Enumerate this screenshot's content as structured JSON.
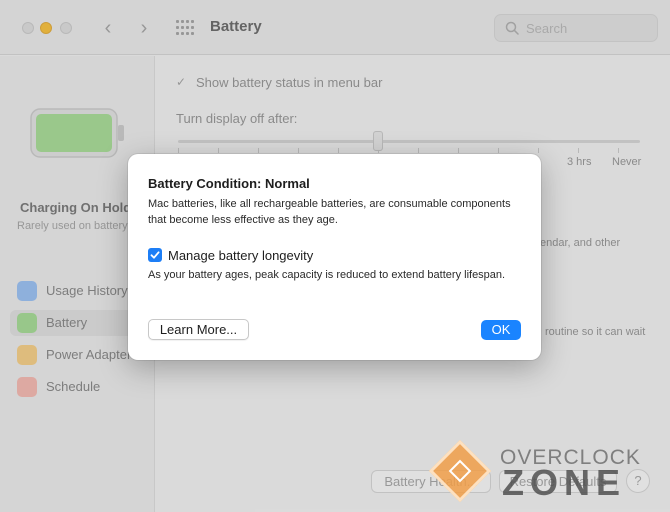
{
  "window": {
    "title": "Battery",
    "search_placeholder": "Search"
  },
  "sidebar": {
    "charging_title": "Charging On Hold",
    "charging_subtitle": "Rarely used on battery",
    "items": [
      {
        "label": "Usage History",
        "icon": "usage-history-icon",
        "color": "#5b9df0"
      },
      {
        "label": "Battery",
        "icon": "battery-icon",
        "color": "#4fc04a"
      },
      {
        "label": "Power Adapter",
        "icon": "power-adapter-icon",
        "color": "#f0a52b"
      },
      {
        "label": "Schedule",
        "icon": "schedule-icon",
        "color": "#e85a4f"
      }
    ]
  },
  "main": {
    "show_status_label": "Show battery status in menu bar",
    "show_status_checked": true,
    "display_off_label": "Turn display off after:",
    "slider_labels": {
      "hrs3": "3 hrs",
      "never": "Never"
    },
    "partial_text_1": "endar, and other",
    "partial_text_2": "routine so it can wait",
    "battery_health_button": "Battery Health...",
    "restore_defaults_button": "Restore Defaults",
    "help_button": "?"
  },
  "dialog": {
    "title": "Battery Condition: Normal",
    "body": "Mac batteries, like all rechargeable batteries, are consumable components that become less effective as they age.",
    "checkbox_label": "Manage battery longevity",
    "checkbox_checked": true,
    "note": "As your battery ages, peak capacity is reduced to extend battery lifespan.",
    "learn_more_button": "Learn More...",
    "ok_button": "OK"
  },
  "watermark": {
    "line1": "OVERCLOCK",
    "line2": "ZONE",
    "accent_color": "#f09e48"
  }
}
